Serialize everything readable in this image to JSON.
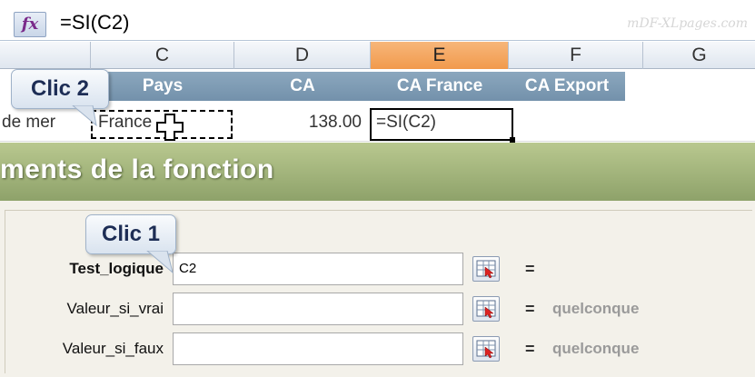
{
  "formula_bar": {
    "fx_label": "fx",
    "formula": "=SI(C2)",
    "watermark": "mDF-XLpages.com"
  },
  "columns": [
    "C",
    "D",
    "E",
    "F",
    "G"
  ],
  "header_row": {
    "pays": "Pays",
    "ca": "CA",
    "ca_france": "CA France",
    "ca_export": "CA Export"
  },
  "data_row": {
    "left_text": "de mer",
    "pays_value": "France",
    "ca_value": "138.00",
    "formula_cell": "=SI(C2)"
  },
  "dialog": {
    "title": "ments de la fonction",
    "args": [
      {
        "label": "Test_logique",
        "value": "C2",
        "result": ""
      },
      {
        "label": "Valeur_si_vrai",
        "value": "",
        "result": "quelconque"
      },
      {
        "label": "Valeur_si_faux",
        "value": "",
        "result": "quelconque"
      }
    ],
    "equals": "="
  },
  "callouts": {
    "clic2": "Clic 2",
    "clic1": "Clic 1"
  },
  "colors": {
    "active_column": "#f19a4c",
    "header_band": "#7f9bb4",
    "dialog_title": "#9eb07a"
  }
}
